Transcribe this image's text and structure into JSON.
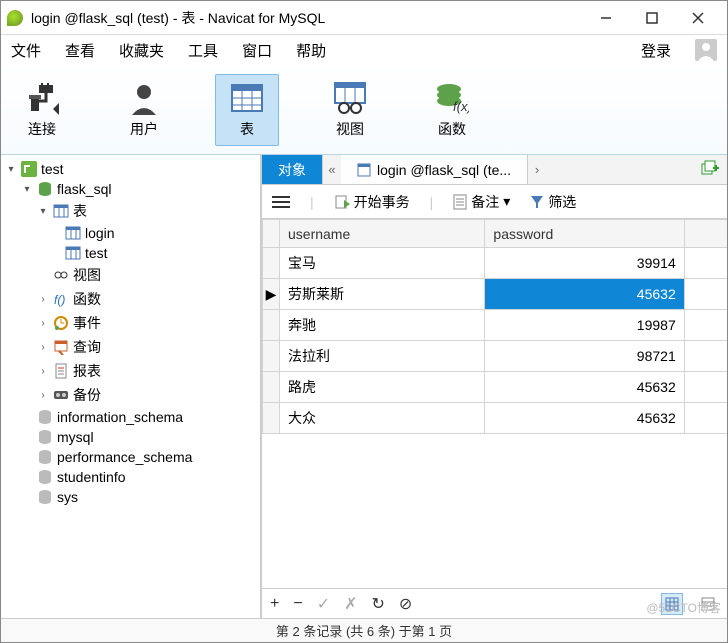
{
  "window": {
    "title": "login @flask_sql (test) - 表 - Navicat for MySQL"
  },
  "menu": {
    "file": "文件",
    "view": "查看",
    "fav": "收藏夹",
    "tools": "工具",
    "window": "窗口",
    "help": "帮助",
    "login": "登录"
  },
  "tools": {
    "connection": "连接",
    "user": "用户",
    "table": "表",
    "view": "视图",
    "function": "函数"
  },
  "tree": {
    "conn": "test",
    "db": "flask_sql",
    "tables_label": "表",
    "tables": [
      "login",
      "test"
    ],
    "views": "视图",
    "functions": "函数",
    "events": "事件",
    "queries": "查询",
    "reports": "报表",
    "backups": "备份",
    "other_dbs": [
      "information_schema",
      "mysql",
      "performance_schema",
      "studentinfo",
      "sys"
    ]
  },
  "tabs": {
    "objects": "对象",
    "data_tab": "login @flask_sql (te..."
  },
  "tabtoolbar": {
    "begin_trans": "开始事务",
    "memo": "备注",
    "filter": "筛选"
  },
  "columns": {
    "c1": "username",
    "c2": "password"
  },
  "rows": [
    {
      "username": "宝马",
      "password": "39914"
    },
    {
      "username": "劳斯莱斯",
      "password": "45632"
    },
    {
      "username": "奔驰",
      "password": "19987"
    },
    {
      "username": "法拉利",
      "password": "98721"
    },
    {
      "username": "路虎",
      "password": "45632"
    },
    {
      "username": "大众",
      "password": "45632"
    }
  ],
  "selected_row_index": 1,
  "status": "第 2 条记录 (共 6 条) 于第 1 页",
  "watermark": "@51CTO博客"
}
